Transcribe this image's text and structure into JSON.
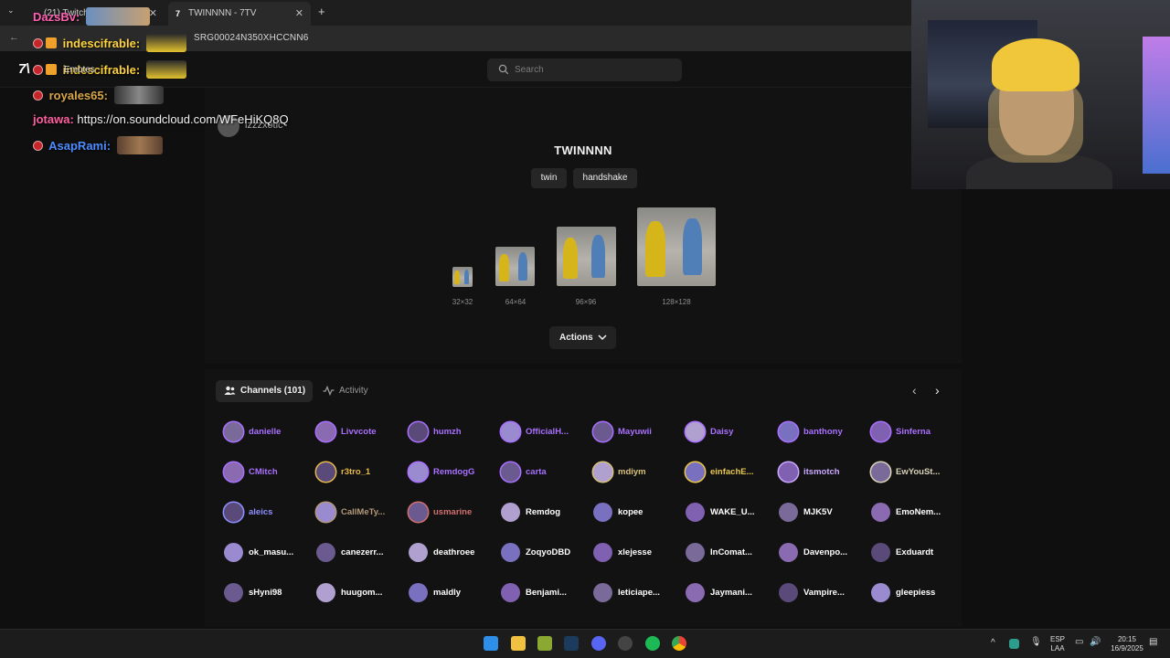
{
  "browser": {
    "tabs": [
      {
        "label": "(21) Twitch",
        "active": false
      },
      {
        "label": "TWINNNN - 7TV",
        "active": true
      }
    ],
    "new_tab": "+",
    "url": "SRG00024N350XHCCNN6"
  },
  "site": {
    "search_placeholder": "Search"
  },
  "emote": {
    "owner": "izzzxotic",
    "name": "TWINNNN",
    "tags": [
      "twin",
      "handshake"
    ],
    "sizes": [
      "32×32",
      "64×64",
      "96×96",
      "128×128"
    ],
    "actions_label": "Actions"
  },
  "channels_section": {
    "tab_channels": "Channels (101)",
    "tab_activity": "Activity",
    "rows": [
      [
        {
          "name": "danielle",
          "color": "#a970ff"
        },
        {
          "name": "Livvcote",
          "color": "#a970ff"
        },
        {
          "name": "humzh",
          "color": "#a970ff"
        },
        {
          "name": "OfficialH...",
          "color": "#a970ff"
        },
        {
          "name": "Mayuwii",
          "color": "#a970ff"
        },
        {
          "name": "Daisy",
          "color": "#a970ff"
        },
        {
          "name": "banthony",
          "color": "#a970ff"
        },
        {
          "name": "Sinferna",
          "color": "#a970ff"
        }
      ],
      [
        {
          "name": "CMitch",
          "color": "#a970ff"
        },
        {
          "name": "r3tro_1",
          "color": "#e6b84a"
        },
        {
          "name": "RemdogG",
          "color": "#a970ff"
        },
        {
          "name": "carta",
          "color": "#a970ff"
        },
        {
          "name": "mdiym",
          "color": "#d8c07a"
        },
        {
          "name": "einfachE...",
          "color": "#e8c84a"
        },
        {
          "name": "itsmotch",
          "color": "#c9a8ff"
        },
        {
          "name": "EwYouSt...",
          "color": "#d9d3b8"
        }
      ],
      [
        {
          "name": "aleics",
          "color": "#8f8fff"
        },
        {
          "name": "CallMeTy...",
          "color": "#b49a7a"
        },
        {
          "name": "usmarine",
          "color": "#d07070"
        },
        {
          "name": "Remdog",
          "color": "#ffffff"
        },
        {
          "name": "kopee",
          "color": "#ffffff"
        },
        {
          "name": "WAKE_U...",
          "color": "#ffffff"
        },
        {
          "name": "MJK5V",
          "color": "#ffffff"
        },
        {
          "name": "EmoNem...",
          "color": "#ffffff"
        }
      ],
      [
        {
          "name": "ok_masu...",
          "color": "#ffffff"
        },
        {
          "name": "canezerr...",
          "color": "#ffffff"
        },
        {
          "name": "deathroee",
          "color": "#ffffff"
        },
        {
          "name": "ZoqyoDBD",
          "color": "#ffffff"
        },
        {
          "name": "xlejesse",
          "color": "#ffffff"
        },
        {
          "name": "InComat...",
          "color": "#ffffff"
        },
        {
          "name": "Davenpo...",
          "color": "#ffffff"
        },
        {
          "name": "Exduardt",
          "color": "#ffffff"
        }
      ],
      [
        {
          "name": "sHyni98",
          "color": "#ffffff"
        },
        {
          "name": "huugom...",
          "color": "#ffffff"
        },
        {
          "name": "maldly",
          "color": "#ffffff"
        },
        {
          "name": "Benjami...",
          "color": "#ffffff"
        },
        {
          "name": "leticiape...",
          "color": "#ffffff"
        },
        {
          "name": "Jaymani...",
          "color": "#ffffff"
        },
        {
          "name": "Vampire...",
          "color": "#ffffff"
        },
        {
          "name": "gleepiess",
          "color": "#ffffff"
        }
      ]
    ]
  },
  "chat_overlay": {
    "messages": [
      {
        "user": "DazsBv:",
        "color": "#ff5fb0",
        "text": ""
      },
      {
        "user": "indescifrable:",
        "color": "#ffd43a",
        "text": ""
      },
      {
        "user": "indescifrable:",
        "color": "#ffd43a",
        "text": ""
      },
      {
        "user": "royales65:",
        "color": "#d7a648",
        "text": ""
      },
      {
        "user": "jotawa:",
        "color": "#ff5fa0",
        "text": "https://on.soundcloud.com/WFeHiKQ8Q"
      },
      {
        "user": "AsapRami:",
        "color": "#4d8cff",
        "text": ""
      }
    ],
    "overlay_label": "Emotes"
  },
  "taskbar": {
    "language": "ESP",
    "region": "LAA",
    "time": "20:15",
    "date": "16/9/2025"
  }
}
